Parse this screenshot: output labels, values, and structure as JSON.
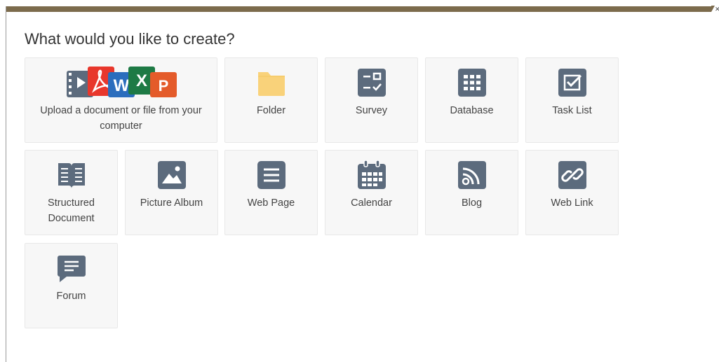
{
  "dialog": {
    "title": "What would you like to create?",
    "close_icon": "close-icon"
  },
  "tiles": [
    {
      "key": "upload",
      "label": "Upload a document or file from your computer",
      "icon": "file-types-icon"
    },
    {
      "key": "folder",
      "label": "Folder",
      "icon": "folder-icon"
    },
    {
      "key": "survey",
      "label": "Survey",
      "icon": "survey-icon"
    },
    {
      "key": "database",
      "label": "Database",
      "icon": "database-grid-icon"
    },
    {
      "key": "tasklist",
      "label": "Task List",
      "icon": "checkbox-icon"
    },
    {
      "key": "structured",
      "label": "Structured Document",
      "icon": "book-icon"
    },
    {
      "key": "album",
      "label": "Picture Album",
      "icon": "picture-icon"
    },
    {
      "key": "webpage",
      "label": "Web Page",
      "icon": "page-lines-icon"
    },
    {
      "key": "calendar",
      "label": "Calendar",
      "icon": "calendar-icon"
    },
    {
      "key": "blog",
      "label": "Blog",
      "icon": "rss-icon"
    },
    {
      "key": "weblink",
      "label": "Web Link",
      "icon": "link-icon"
    },
    {
      "key": "forum",
      "label": "Forum",
      "icon": "chat-icon"
    }
  ],
  "file_type_letters": {
    "word": "W",
    "excel": "X",
    "powerpoint": "P"
  },
  "colors": {
    "icon": "#5c6b7d",
    "folder": "#f9d27a",
    "pdf": "#e8372c",
    "word": "#2b6dbd",
    "excel": "#1e7a45",
    "powerpoint": "#e45b2a",
    "header_bar": "#7c6b4c"
  }
}
